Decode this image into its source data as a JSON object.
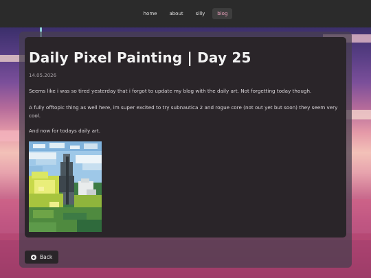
{
  "nav": {
    "items": [
      {
        "label": "home",
        "active": false
      },
      {
        "label": "about",
        "active": false
      },
      {
        "label": "silly",
        "active": false
      },
      {
        "label": "blog",
        "active": true
      }
    ],
    "active_color": "#f4a6c3"
  },
  "post": {
    "title": "Daily Pixel Painting | Day 25",
    "date": "14.05.2026",
    "paragraphs": [
      "Seems like i was so tired yesterday that i forgot to update my blog with the daily art. Not forgetting today though.",
      "A fully offtopic thing as well here, im super excited to try subnautica 2 and rogue core (not out yet but soon) they seem very cool.",
      "And now for todays daily art."
    ],
    "image_label": "pixel-painting"
  },
  "back": {
    "label": "Back",
    "icon": "arrow-left-circle-icon"
  }
}
